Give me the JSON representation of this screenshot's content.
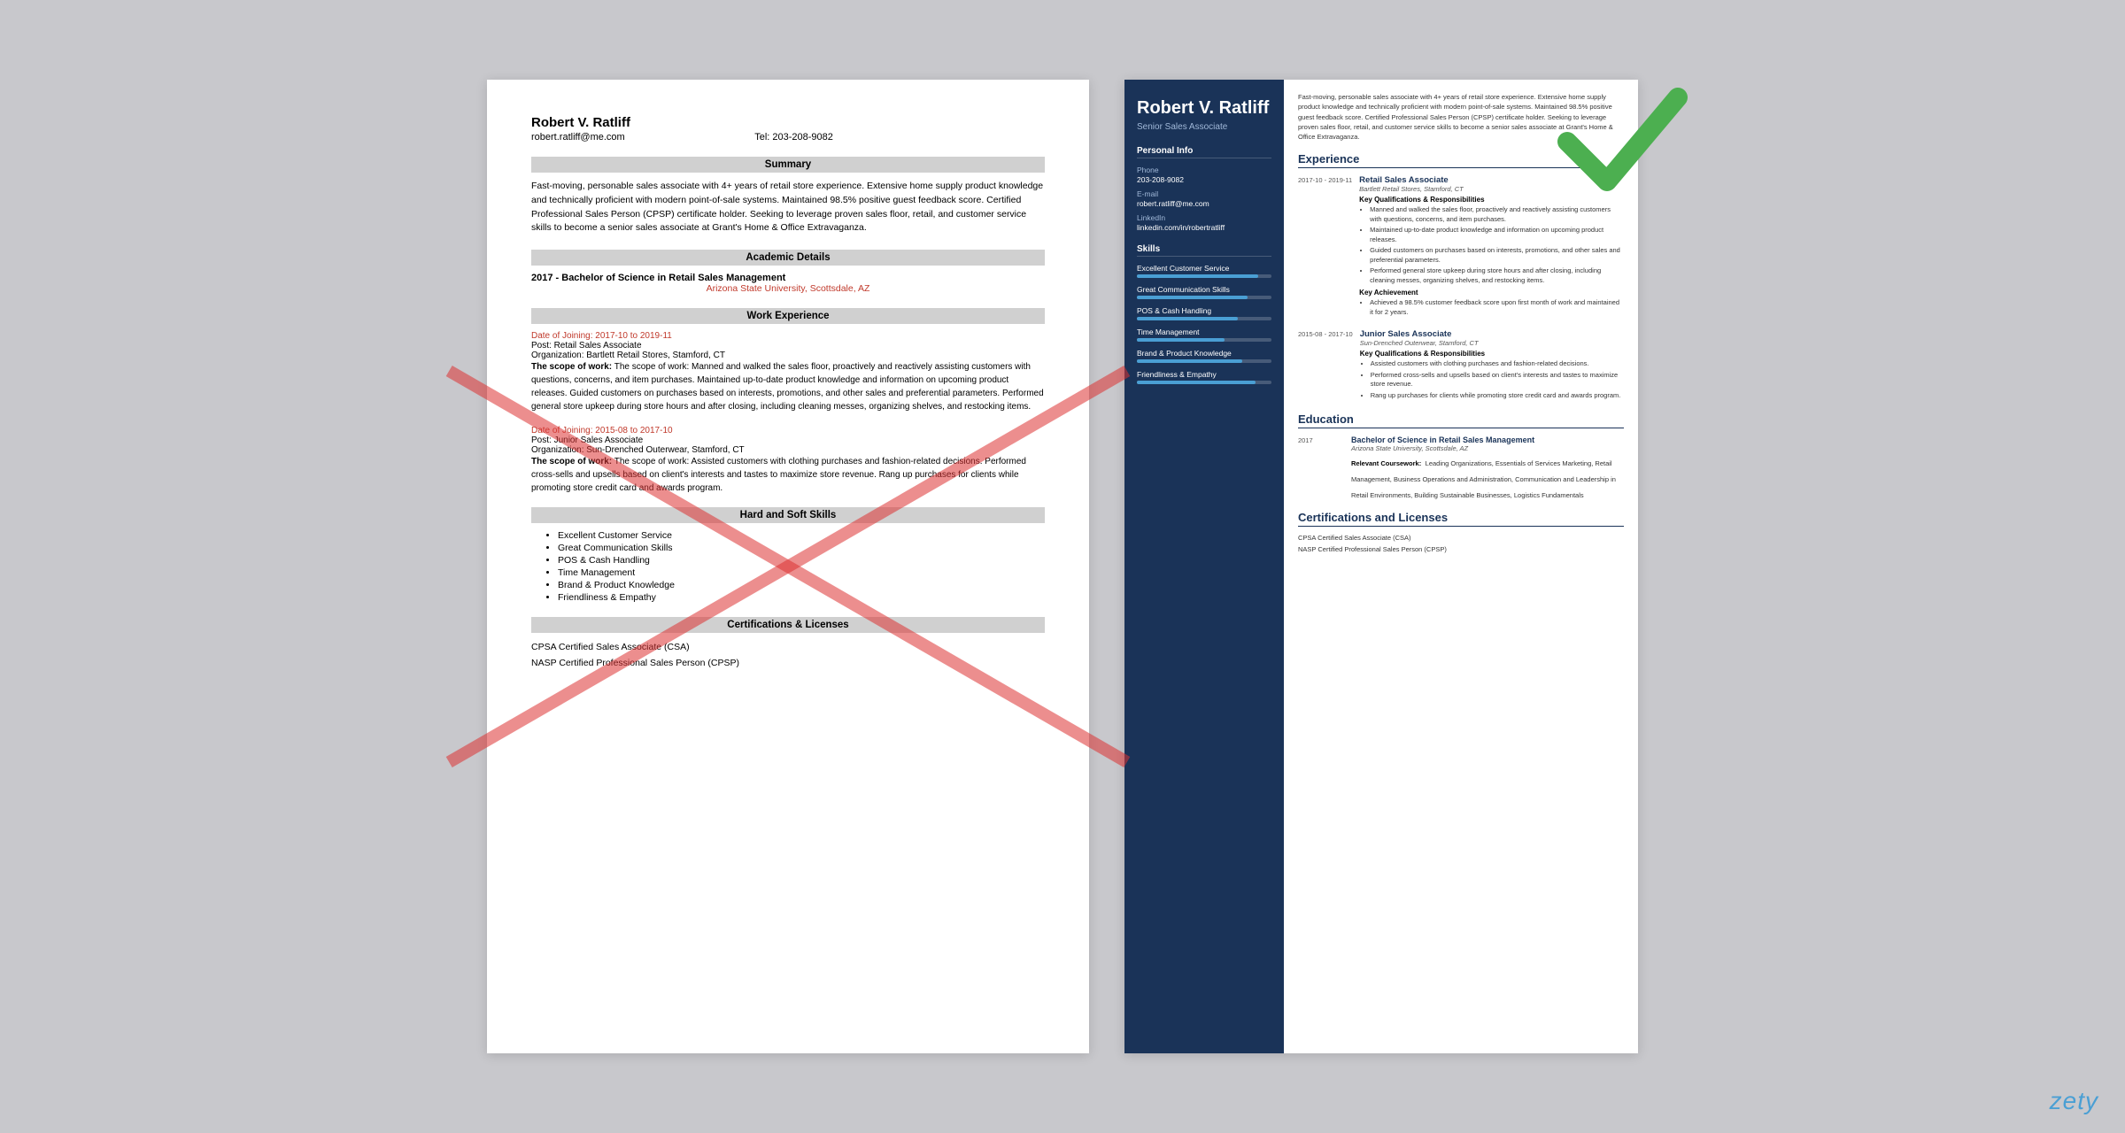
{
  "brand": "zety",
  "leftResume": {
    "name": "Robert V. Ratliff",
    "email": "robert.ratliff@me.com",
    "tel": "Tel: 203-208-9082",
    "sections": {
      "summary": {
        "title": "Summary",
        "text": "Fast-moving, personable sales associate with 4+ years of retail store experience. Extensive home supply product knowledge and technically proficient with modern point-of-sale systems. Maintained 98.5% positive guest feedback score. Certified Professional Sales Person (CPSP) certificate holder. Seeking to leverage proven sales floor, retail, and customer service skills to become a senior sales associate at Grant's Home & Office Extravaganza."
      },
      "academic": {
        "title": "Academic Details",
        "degree": "2017 - Bachelor of Science in Retail Sales Management",
        "school": "Arizona State University, Scottsdale, AZ"
      },
      "workExperience": {
        "title": "Work Experience",
        "entries": [
          {
            "date": "Date of Joining: 2017-10 to 2019-11",
            "post": "Post: Retail Sales Associate",
            "org": "Organization: Bartlett Retail Stores, Stamford, CT",
            "scope": "The scope of work: Manned and walked the sales floor, proactively and reactively assisting customers with questions, concerns, and item purchases. Maintained up-to-date product knowledge and information on upcoming product releases. Guided customers on purchases based on interests, promotions, and other sales and preferential parameters. Performed general store upkeep during store hours and after closing, including cleaning messes, organizing shelves, and restocking items."
          },
          {
            "date": "Date of Joining: 2015-08 to 2017-10",
            "post": "Post: Junior Sales Associate",
            "org": "Organization: Sun-Drenched Outerwear, Stamford, CT",
            "scope": "The scope of work: Assisted customers with clothing purchases and fashion-related decisions. Performed cross-sells and upsells based on client's interests and tastes to maximize store revenue. Rang up purchases for clients while promoting store credit card and awards program."
          }
        ]
      },
      "hardSoftSkills": {
        "title": "Hard and Soft Skills",
        "skills": [
          "Excellent Customer Service",
          "Great Communication Skills",
          "POS & Cash Handling",
          "Time Management",
          "Brand & Product Knowledge",
          "Friendliness & Empathy"
        ]
      },
      "certifications": {
        "title": "Certifications & Licenses",
        "items": [
          "CPSA Certified Sales Associate (CSA)",
          "NASP Certified Professional Sales Person (CPSP)"
        ]
      }
    }
  },
  "rightResume": {
    "name": "Robert V. Ratliff",
    "title": "Senior Sales Associate",
    "personalInfo": {
      "sectionTitle": "Personal Info",
      "phoneLabel": "Phone",
      "phone": "203-208-9082",
      "emailLabel": "E-mail",
      "email": "robert.ratliff@me.com",
      "linkedinLabel": "LinkedIn",
      "linkedin": "linkedin.com/in/robertratliff"
    },
    "skillsSection": {
      "sectionTitle": "Skills",
      "skills": [
        {
          "name": "Excellent Customer Service",
          "pct": 90
        },
        {
          "name": "Great Communication Skills",
          "pct": 82
        },
        {
          "name": "POS & Cash Handling",
          "pct": 75
        },
        {
          "name": "Time Management",
          "pct": 65
        },
        {
          "name": "Brand & Product Knowledge",
          "pct": 78
        },
        {
          "name": "Friendliness & Empathy",
          "pct": 88
        }
      ]
    },
    "summary": "Fast-moving, personable sales associate with 4+ years of retail store experience. Extensive home supply product knowledge and technically proficient with modern point-of-sale systems. Maintained 98.5% positive guest feedback score. Certified Professional Sales Person (CPSP) certificate holder. Seeking to leverage proven sales floor, retail, and customer service skills to become a senior sales associate at Grant's Home & Office Extravaganza.",
    "experience": {
      "sectionTitle": "Experience",
      "entries": [
        {
          "dateRange": "2017-10 - 2019-11",
          "jobTitle": "Retail Sales Associate",
          "company": "Bartlett Retail Stores, Stamford, CT",
          "qualTitle": "Key Qualifications & Responsibilities",
          "bullets": [
            "Manned and walked the sales floor, proactively and reactively assisting customers with questions, concerns, and item purchases.",
            "Maintained up-to-date product knowledge and information on upcoming product releases.",
            "Guided customers on purchases based on interests, promotions, and other sales and preferential parameters.",
            "Performed general store upkeep during store hours and after closing, including cleaning messes, organizing shelves, and restocking items."
          ],
          "achievementTitle": "Key Achievement",
          "achievements": [
            "Achieved a 98.5% customer feedback score upon first month of work and maintained it for 2 years."
          ]
        },
        {
          "dateRange": "2015-08 - 2017-10",
          "jobTitle": "Junior Sales Associate",
          "company": "Sun-Drenched Outerwear, Stamford, CT",
          "qualTitle": "Key Qualifications & Responsibilities",
          "bullets": [
            "Assisted customers with clothing purchases and fashion-related decisions.",
            "Performed cross-sells and upsells based on client's interests and tastes to maximize store revenue.",
            "Rang up purchases for clients while promoting store credit card and awards program."
          ]
        }
      ]
    },
    "education": {
      "sectionTitle": "Education",
      "entries": [
        {
          "year": "2017",
          "degree": "Bachelor of Science in Retail Sales Management",
          "school": "Arizona State University, Scottsdale, AZ",
          "courseworkLabel": "Relevant Coursework:",
          "coursework": "Leading Organizations, Essentials of Services Marketing, Retail Management, Business Operations and Administration, Communication and Leadership in Retail Environments, Building Sustainable Businesses, Logistics Fundamentals"
        }
      ]
    },
    "certifications": {
      "sectionTitle": "Certifications and Licenses",
      "items": [
        "CPSA Certified Sales Associate (CSA)",
        "NASP Certified Professional Sales Person (CPSP)"
      ]
    }
  }
}
